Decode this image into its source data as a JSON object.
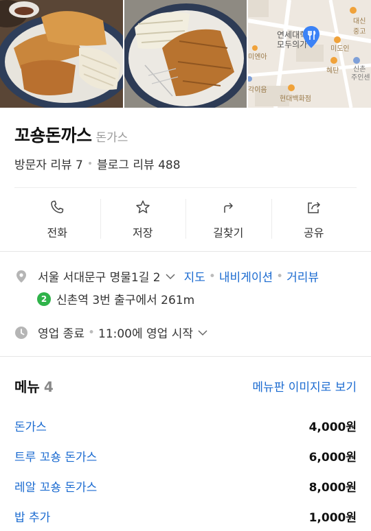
{
  "place": {
    "name": "꼬숑돈까스",
    "category": "돈가스",
    "visitor_reviews": "방문자 리뷰 7",
    "blog_reviews": "블로그 리뷰 488"
  },
  "actions": [
    {
      "label": "전화",
      "icon": "phone-icon"
    },
    {
      "label": "저장",
      "icon": "star-icon"
    },
    {
      "label": "길찾기",
      "icon": "directions-icon"
    },
    {
      "label": "공유",
      "icon": "share-icon"
    }
  ],
  "address": {
    "text": "서울 서대문구 명물1길 2",
    "map_link": "지도",
    "navi_link": "내비게이션",
    "street_link": "거리뷰"
  },
  "subway": {
    "line": "2",
    "line_color": "#2fb34a",
    "text": "신촌역 3번 출구에서 261m"
  },
  "hours": {
    "status": "영업 종료",
    "next": "11:00에 영업 시작"
  },
  "menu": {
    "title": "메뉴",
    "count": "4",
    "image_link": "메뉴판 이미지로 보기",
    "items": [
      {
        "name": "돈가스",
        "price": "4,000원"
      },
      {
        "name": "트루 꼬숑 돈가스",
        "price": "6,000원"
      },
      {
        "name": "레알 꼬숑 돈가스",
        "price": "8,000원"
      },
      {
        "name": "밥 추가",
        "price": "1,000원"
      }
    ]
  },
  "map_labels": {
    "top_right": "대신중고",
    "school": "연세대학",
    "store": "모두의가",
    "label_a": "미도인",
    "label_b": "신촌",
    "label_c": "주인센",
    "label_d": "혜탄",
    "label_e": "미엔아",
    "label_f": "각이음",
    "dept": "현대백화점"
  },
  "colors": {
    "link": "#1a6ad0",
    "map_pin": "#3b82f6"
  }
}
